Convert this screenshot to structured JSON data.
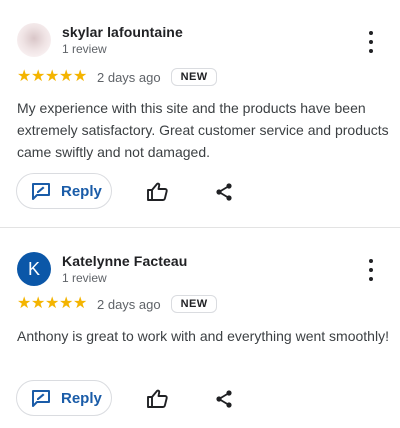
{
  "reviews": [
    {
      "author": "skylar lafountaine",
      "review_count": "1 review",
      "stars": "★★★★★",
      "rating": 5,
      "age": "2 days ago",
      "badge": "NEW",
      "text": "My experience with this site and the products have been extremely satisfactory. Great customer service and products came swiftly and not damaged.",
      "reply_label": "Reply"
    },
    {
      "author": "Katelynne Facteau",
      "avatar_initial": "K",
      "review_count": "1 review",
      "stars": "★★★★★",
      "rating": 5,
      "age": "2 days ago",
      "badge": "NEW",
      "text": "Anthony is great to work with and everything went smoothly!",
      "reply_label": "Reply"
    }
  ],
  "icons": [
    "more-options-icon",
    "reply-icon",
    "thumbs-up-icon",
    "share-icon"
  ],
  "colors": {
    "star": "#f4b400",
    "reply_text": "#1a5ca8",
    "avatar_k": "#0b57a8"
  }
}
